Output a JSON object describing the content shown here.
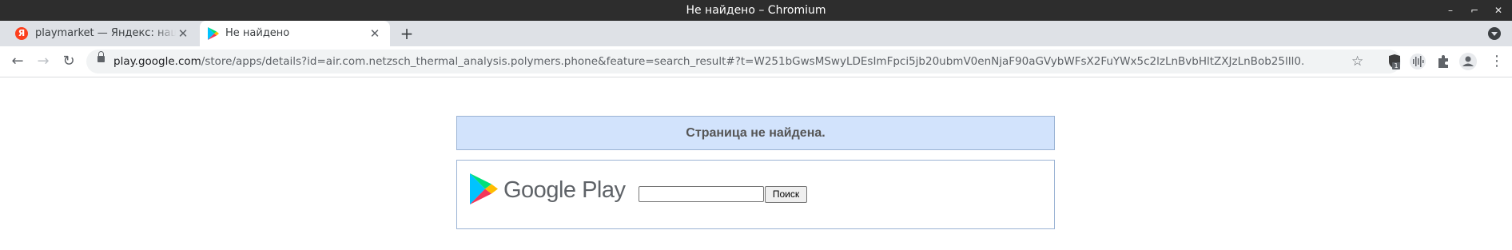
{
  "window": {
    "title": "Не найдено – Chromium",
    "controls": {
      "minimize": "–",
      "restore": "⌐",
      "close": "✕"
    }
  },
  "tabs": [
    {
      "label": "playmarket — Яндекс: нашло",
      "icon": "yandex-icon",
      "active": false,
      "close": "✕"
    },
    {
      "label": "Не найдено",
      "icon": "google-play-icon",
      "active": true,
      "close": "✕"
    }
  ],
  "tabstrip": {
    "new_tab": "+"
  },
  "toolbar": {
    "url_host": "play.google.com",
    "url_path": "/store/apps/details?id=air.com.netzsch_thermal_analysis.polymers.phone&feature=search_result#?t=W251bGwsMSwyLDEsImFpci5jb20ubmV0enNjaF90aGVybWFsX2FuYWx5c2lzLnBvbHltZXJzLnBob25lIl0.",
    "bookmark_star": "☆",
    "extension_badge": "1",
    "menu": "⋮"
  },
  "page": {
    "error_message": "Страница не найдена.",
    "logo_text": "Google Play",
    "search_value": "",
    "search_button": "Поиск"
  },
  "colors": {
    "titlebar": "#2d2d2d",
    "tabstrip": "#dee1e6",
    "error_bar": "#d2e3fc",
    "play_green": "#00d7fe",
    "play_orange": "#ffbc00",
    "play_red": "#f4365a"
  }
}
